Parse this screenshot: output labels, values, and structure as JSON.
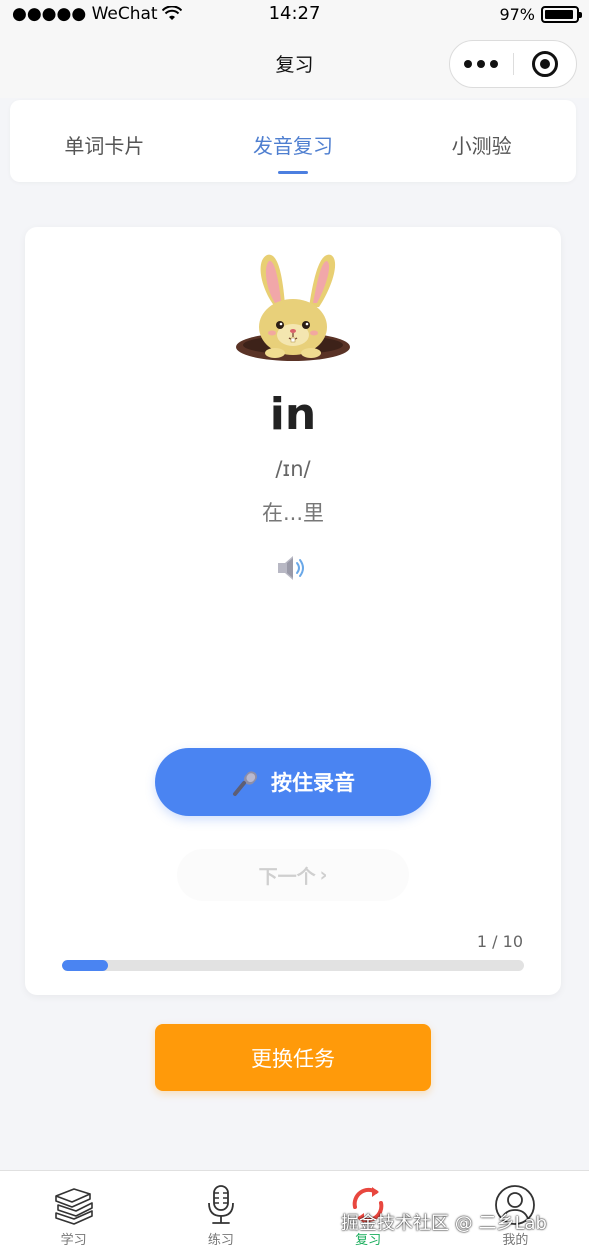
{
  "status_bar": {
    "carrier": "●●●●● WeChat",
    "time": "14:27",
    "battery": "97%",
    "battery_level": 0.97
  },
  "nav": {
    "title": "复习"
  },
  "tabs": [
    {
      "label": "单词卡片",
      "active": false
    },
    {
      "label": "发音复习",
      "active": true
    },
    {
      "label": "小测验",
      "active": false
    }
  ],
  "card": {
    "word": "in",
    "phonetic": "/ɪn/",
    "meaning": "在...里",
    "record_label": "按住录音",
    "next_label": "下一个",
    "next_arrow": "›",
    "progress_text": "1 / 10",
    "progress_current": 1,
    "progress_total": 10
  },
  "change_task_label": "更换任务",
  "tabbar": [
    {
      "label": "学习",
      "icon": "books-icon"
    },
    {
      "label": "练习",
      "icon": "microphone-icon"
    },
    {
      "label": "复习",
      "icon": "refresh-icon",
      "active": true
    },
    {
      "label": "我的",
      "icon": "profile-icon"
    }
  ],
  "watermark": "掘金技术社区 @ 二乡Lab",
  "colors": {
    "primary_blue": "#4a84f2",
    "active_tab": "#4f7fd0",
    "orange": "#ff9a0a",
    "active_tabbar": "#1aad5c"
  }
}
